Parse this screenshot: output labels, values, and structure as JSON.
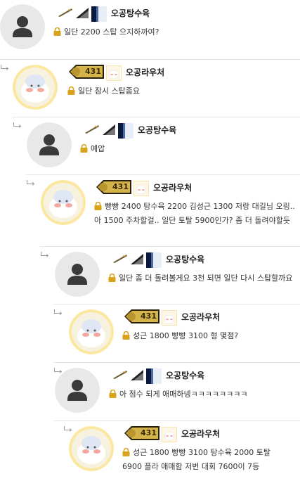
{
  "users": {
    "a": {
      "nick": "오공탕수육"
    },
    "b": {
      "nick": "오공라우처",
      "level": "431"
    }
  },
  "comments": [
    {
      "user": "a",
      "text": "일단 2200 스탑 으지하까여?"
    },
    {
      "user": "b",
      "text": "일단 잠시 스탑좀요"
    },
    {
      "user": "a",
      "text": "예압"
    },
    {
      "user": "b",
      "text_lines": [
        "빵빵 2400 탕수육 2200 김성근 1300  저랑 대길님 오링..",
        "아 1500 주차할걸.. 일단 토탈 5900인가? 좀 더 돌려야할듯"
      ]
    },
    {
      "user": "a",
      "text": "일단 좀 더 돌려볼게요 3천 되면 일단 다시 스탑할까요"
    },
    {
      "user": "b",
      "text": "성근 1800 빵빵 3100  형 몇점?"
    },
    {
      "user": "a",
      "text": "아 점수 되게 애매하넹ㅋㅋㅋㅋㅋㅋㅋㅋ"
    },
    {
      "user": "b",
      "text_lines": [
        "성근 1800 빵빵 3100 탕수육 2000  토탈",
        "6900 플라 애매함 저번 대회 7600이 7등"
      ]
    }
  ],
  "colors": {
    "divider": "#e6e6e6",
    "lock": "#d9a31b",
    "text": "#333333"
  },
  "icons": [
    "reply-arrow-icon",
    "lock-icon",
    "default-avatar-icon",
    "rank-badge-icon",
    "level-badge-icon"
  ]
}
